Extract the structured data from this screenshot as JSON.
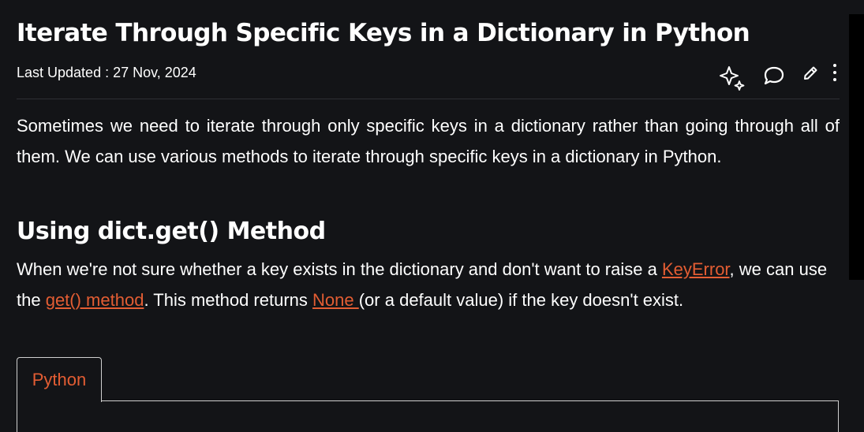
{
  "article": {
    "title": "Iterate Through Specific Keys in a Dictionary in Python",
    "last_updated": "Last Updated : 27 Nov, 2024",
    "intro": "Sometimes we need to iterate through only specific keys in a dictionary rather than going through all of them. We can use various methods to iterate through specific keys in a dictionary in Python.",
    "section1": {
      "heading": "Using dict.get() Method",
      "p_part1": "When we're not sure whether a key exists in the dictionary and don't want to raise a ",
      "link_keyerror": "KeyError",
      "p_part2": ", we can use the ",
      "link_get": "get() method",
      "p_part3": ". This method returns ",
      "link_none": "None ",
      "p_part4": "(or a default value) if the key doesn't exist."
    },
    "code_tabs": [
      "Python"
    ]
  },
  "icons": [
    "sparkle-icon",
    "comment-icon",
    "edit-icon",
    "more-icon"
  ],
  "colors": {
    "background": "#131417",
    "link": "#e35d33",
    "text": "#ffffff"
  }
}
